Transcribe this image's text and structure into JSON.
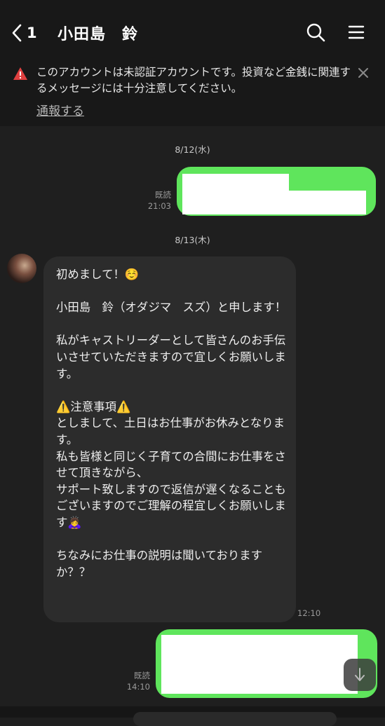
{
  "header": {
    "unread_count": "1",
    "title": "小田島　鈴"
  },
  "notice": {
    "text": "このアカウントは未認証アカウントです。投資など金銭に関連するメッセージには十分注意してください。",
    "report_link": "通報する"
  },
  "messages": {
    "date1": "8/12(水)",
    "out1": {
      "read_label": "既読",
      "time": "21:03"
    },
    "date2": "8/13(木)",
    "in1": {
      "text": "初めまして！☺️\n\n小田島　鈴（オダジマ　スズ）と申します！\n\n私がキャストリーダーとして皆さんのお手伝いさせていただきますので宜しくお願いします。\n\n⚠️注意事項⚠️\nとしまして、土日はお仕事がお休みとなります。\n私も皆様と同じく子育ての合間にお仕事をさせて頂きながら、\nサポート致しますので返信が遅くなることもございますのでご理解の程宜しくお願いします🙇‍♀️\n\nちなみにお仕事の説明は聞いておりますか？？",
      "time": "12:10"
    },
    "out2": {
      "read_label": "既読",
      "time": "14:10"
    }
  },
  "icons": [
    "back-chevron-icon",
    "search-icon",
    "menu-icon",
    "warning-icon",
    "close-icon",
    "scroll-down-icon"
  ],
  "colors": {
    "accent_green": "#5fe55c",
    "warning_red": "#e04040",
    "background": "#1f1f1f"
  }
}
